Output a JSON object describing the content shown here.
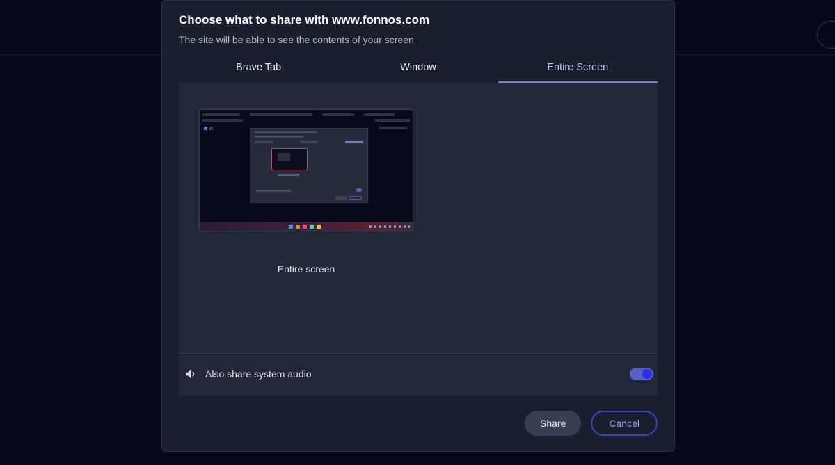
{
  "dialog": {
    "title": "Choose what to share with www.fonnos.com",
    "subtitle": "The site will be able to see the contents of your screen"
  },
  "tabs": {
    "tab1": "Brave Tab",
    "tab2": "Window",
    "tab3": "Entire Screen"
  },
  "option": {
    "label": "Entire screen"
  },
  "audio": {
    "label": "Also share system audio"
  },
  "footer": {
    "share": "Share",
    "cancel": "Cancel"
  }
}
